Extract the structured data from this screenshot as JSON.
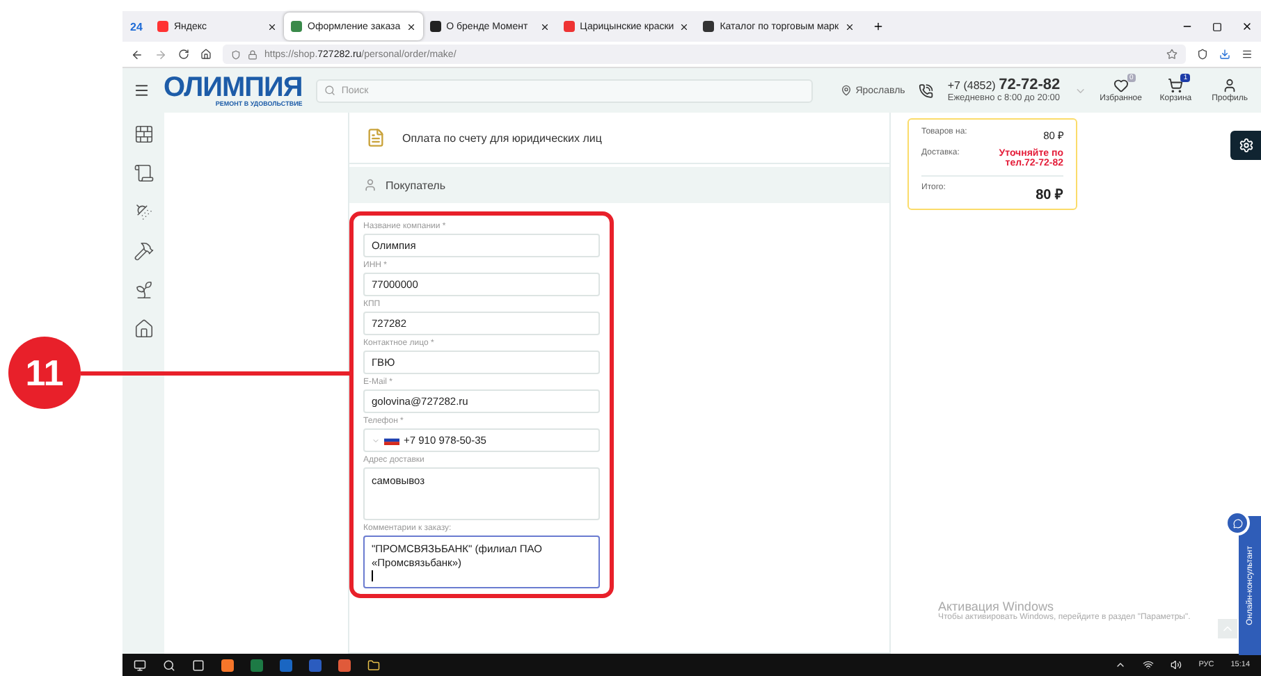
{
  "annotation": {
    "number": "11"
  },
  "browser": {
    "pinned_label": "24",
    "tabs": [
      {
        "label": "Яндекс",
        "selected": false
      },
      {
        "label": "Оформление заказа",
        "selected": true
      },
      {
        "label": "О бренде Момент",
        "selected": false
      },
      {
        "label": "Царицынские краски",
        "selected": false
      },
      {
        "label": "Каталог по торговым марк",
        "selected": false
      }
    ],
    "address_prefix": "https://shop.",
    "address_domain": "727282.ru",
    "address_path": "/personal/order/make/"
  },
  "header": {
    "logo": "ОЛИМПИЯ",
    "slogan": "РЕМОНТ В УДОВОЛЬСТВИЕ",
    "search_placeholder": "Поиск",
    "city": "Ярославль",
    "phone_code": "+7 (4852)",
    "phone_number": "72-72-82",
    "hours": "Ежедневно с 8:00 до 20:00",
    "actions": [
      {
        "label": "Избранное",
        "badge": "0",
        "kind": "heart"
      },
      {
        "label": "Корзина",
        "badge": "1",
        "kind": "cart"
      },
      {
        "label": "Профиль",
        "kind": "user"
      }
    ]
  },
  "payment": {
    "label": "Оплата по счету для юридических лиц"
  },
  "buyer": {
    "title": "Покупатель",
    "fields": [
      {
        "label": "Название компании *",
        "value": "Олимпия",
        "kind": "input"
      },
      {
        "label": "ИНН *",
        "value": "77000000",
        "kind": "input"
      },
      {
        "label": "КПП",
        "value": "727282",
        "kind": "input"
      },
      {
        "label": "Контактное лицо *",
        "value": "ГВЮ",
        "kind": "input"
      },
      {
        "label": "E-Mail *",
        "value": "golovina@727282.ru",
        "kind": "input"
      },
      {
        "label": "Телефон *",
        "value": "+7 910 978-50-35",
        "kind": "phone"
      },
      {
        "label": "Адрес доставки",
        "value": "самовывоз",
        "kind": "textarea"
      },
      {
        "label": "Комментарии к заказу:",
        "value": "\"ПРОМСВЯЗЬБАНК\" (филиал ПАО «Промсвязьбанк»)",
        "kind": "comment"
      }
    ]
  },
  "summary": {
    "rows": [
      {
        "label": "Товаров на:",
        "value": "80 ₽",
        "kind": "normal"
      },
      {
        "label": "Доставка:",
        "value": "Уточняйте по тел.72-72-82",
        "kind": "alert"
      },
      {
        "label": "Итого:",
        "value": "80 ₽",
        "kind": "total"
      }
    ]
  },
  "consultant": "Онлайн-консультант",
  "activation": {
    "title": "Активация Windows",
    "text": "Чтобы активировать Windows, перейдите в раздел \"Параметры\"."
  },
  "taskbar": {
    "language": "РУС",
    "time": "15:14"
  }
}
